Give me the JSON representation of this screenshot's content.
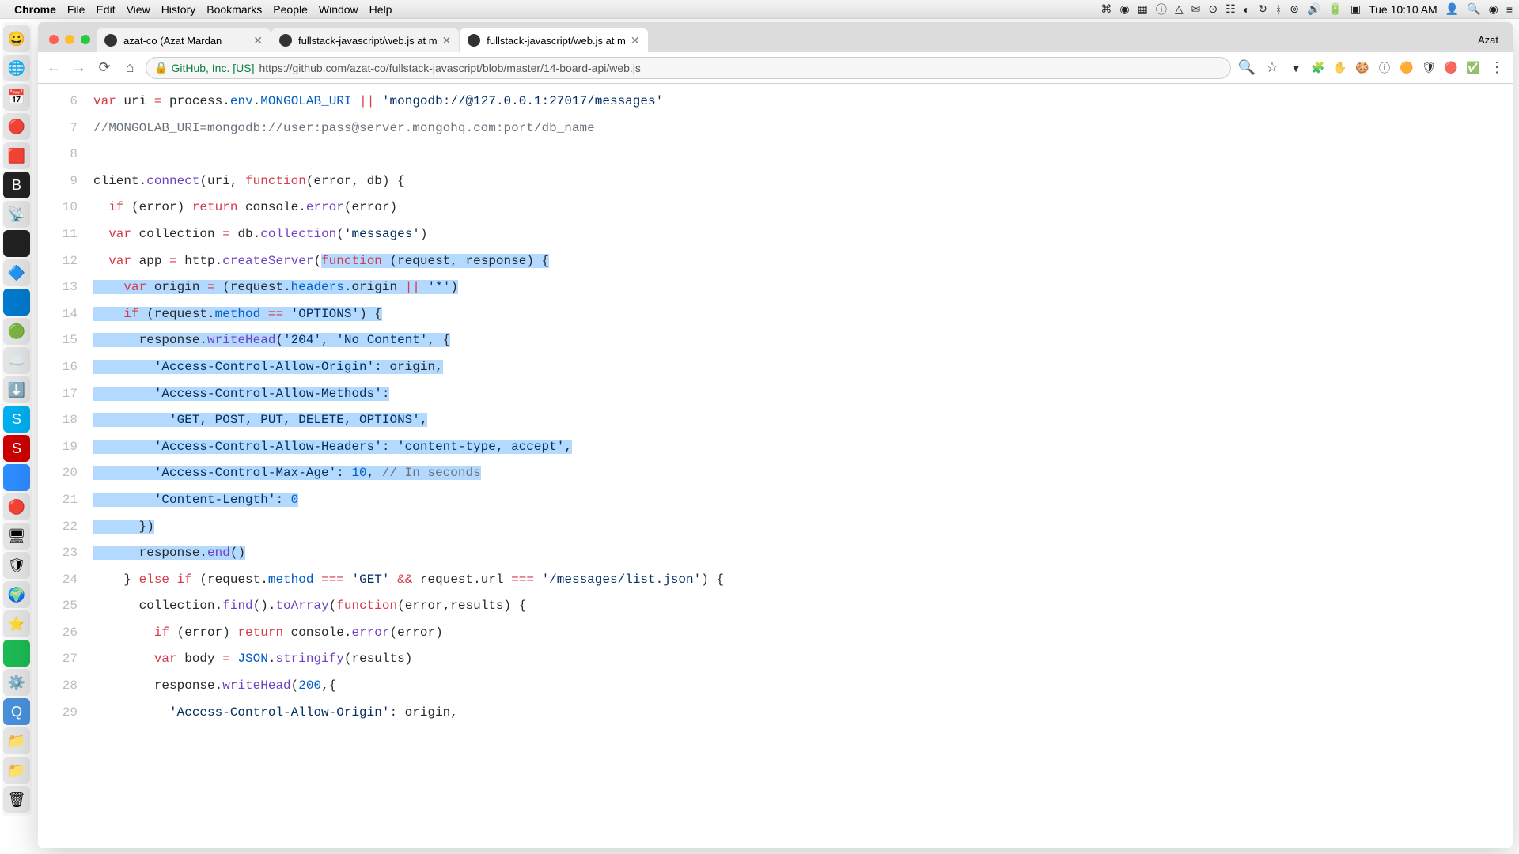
{
  "menubar": {
    "app": "Chrome",
    "items": [
      "File",
      "Edit",
      "View",
      "History",
      "Bookmarks",
      "People",
      "Window",
      "Help"
    ],
    "clock": "Tue 10:10 AM"
  },
  "chrome": {
    "tabs": [
      {
        "title": "azat-co (Azat Mardan",
        "active": false
      },
      {
        "title": "fullstack-javascript/web.js at m",
        "active": false
      },
      {
        "title": "fullstack-javascript/web.js at m",
        "active": true
      }
    ],
    "user": "Azat",
    "security_label": "GitHub, Inc. [US]",
    "url": "https://github.com/azat-co/fullstack-javascript/blob/master/14-board-api/web.js"
  },
  "code": {
    "lines": [
      {
        "n": 6,
        "indent": 0,
        "sel": false,
        "tokens": [
          [
            "kw",
            "var"
          ],
          [
            "id",
            " uri "
          ],
          [
            "kw",
            "="
          ],
          [
            "id",
            " process"
          ],
          [
            "id",
            "."
          ],
          [
            "prop",
            "env"
          ],
          [
            "id",
            "."
          ],
          [
            "const",
            "MONGOLAB_URI"
          ],
          [
            "id",
            " "
          ],
          [
            "kw",
            "||"
          ],
          [
            "id",
            " "
          ],
          [
            "str",
            "'mongodb://@127.0.0.1:27017/messages'"
          ]
        ]
      },
      {
        "n": 7,
        "indent": 0,
        "sel": false,
        "tokens": [
          [
            "cmt",
            "//MONGOLAB_URI=mongodb://user:pass@server.mongohq.com:port/db_name"
          ]
        ]
      },
      {
        "n": 8,
        "indent": 0,
        "sel": false,
        "tokens": []
      },
      {
        "n": 9,
        "indent": 0,
        "sel": false,
        "tokens": [
          [
            "id",
            "client"
          ],
          [
            "id",
            "."
          ],
          [
            "fn",
            "connect"
          ],
          [
            "id",
            "(uri, "
          ],
          [
            "kw",
            "function"
          ],
          [
            "id",
            "(error, db) {"
          ]
        ]
      },
      {
        "n": 10,
        "indent": 1,
        "sel": false,
        "tokens": [
          [
            "kw",
            "if"
          ],
          [
            "id",
            " (error) "
          ],
          [
            "kw",
            "return"
          ],
          [
            "id",
            " console."
          ],
          [
            "fn",
            "error"
          ],
          [
            "id",
            "(error)"
          ]
        ]
      },
      {
        "n": 11,
        "indent": 1,
        "sel": false,
        "tokens": [
          [
            "kw",
            "var"
          ],
          [
            "id",
            " collection "
          ],
          [
            "kw",
            "="
          ],
          [
            "id",
            " db."
          ],
          [
            "fn",
            "collection"
          ],
          [
            "id",
            "("
          ],
          [
            "str",
            "'messages'"
          ],
          [
            "id",
            ")"
          ]
        ]
      },
      {
        "n": 12,
        "indent": 1,
        "sel": "partial",
        "unsel_tokens": [
          [
            "kw",
            "var"
          ],
          [
            "id",
            " app "
          ],
          [
            "kw",
            "="
          ],
          [
            "id",
            " http."
          ],
          [
            "fn",
            "createServer"
          ],
          [
            "id",
            "("
          ]
        ],
        "sel_tokens": [
          [
            "kw",
            "function"
          ],
          [
            "id",
            " (request, response) {"
          ]
        ]
      },
      {
        "n": 13,
        "indent": 2,
        "sel": true,
        "tokens": [
          [
            "kw",
            "var"
          ],
          [
            "id",
            " origin "
          ],
          [
            "kw",
            "="
          ],
          [
            "id",
            " (request."
          ],
          [
            "prop",
            "headers"
          ],
          [
            "id",
            ".origin "
          ],
          [
            "kw",
            "||"
          ],
          [
            "id",
            " "
          ],
          [
            "str",
            "'*'"
          ],
          [
            "id",
            ")"
          ]
        ]
      },
      {
        "n": 14,
        "indent": 2,
        "sel": true,
        "tokens": [
          [
            "kw",
            "if"
          ],
          [
            "id",
            " (request."
          ],
          [
            "prop",
            "method"
          ],
          [
            "id",
            " "
          ],
          [
            "kw",
            "=="
          ],
          [
            "id",
            " "
          ],
          [
            "str",
            "'OPTIONS'"
          ],
          [
            "id",
            ") {"
          ]
        ]
      },
      {
        "n": 15,
        "indent": 3,
        "sel": true,
        "tokens": [
          [
            "id",
            "response."
          ],
          [
            "fn",
            "writeHead"
          ],
          [
            "id",
            "("
          ],
          [
            "str",
            "'204'"
          ],
          [
            "id",
            ", "
          ],
          [
            "str",
            "'No Content'"
          ],
          [
            "id",
            ", {"
          ]
        ]
      },
      {
        "n": 16,
        "indent": 4,
        "sel": true,
        "tokens": [
          [
            "str",
            "'Access-Control-Allow-Origin'"
          ],
          [
            "id",
            ": origin,"
          ]
        ]
      },
      {
        "n": 17,
        "indent": 4,
        "sel": true,
        "tokens": [
          [
            "str",
            "'Access-Control-Allow-Methods'"
          ],
          [
            "id",
            ":"
          ]
        ]
      },
      {
        "n": 18,
        "indent": 5,
        "sel": true,
        "tokens": [
          [
            "str",
            "'GET, POST, PUT, DELETE, OPTIONS'"
          ],
          [
            "id",
            ","
          ]
        ]
      },
      {
        "n": 19,
        "indent": 4,
        "sel": true,
        "tokens": [
          [
            "str",
            "'Access-Control-Allow-Headers'"
          ],
          [
            "id",
            ": "
          ],
          [
            "str",
            "'content-type, accept'"
          ],
          [
            "id",
            ","
          ]
        ]
      },
      {
        "n": 20,
        "indent": 4,
        "sel": true,
        "tokens": [
          [
            "str",
            "'Access-Control-Max-Age'"
          ],
          [
            "id",
            ": "
          ],
          [
            "num",
            "10"
          ],
          [
            "id",
            ", "
          ],
          [
            "cmt",
            "// In seconds"
          ]
        ]
      },
      {
        "n": 21,
        "indent": 4,
        "sel": true,
        "tokens": [
          [
            "str",
            "'Content-Length'"
          ],
          [
            "id",
            ": "
          ],
          [
            "num",
            "0"
          ]
        ]
      },
      {
        "n": 22,
        "indent": 3,
        "sel": true,
        "tokens": [
          [
            "id",
            "})"
          ]
        ]
      },
      {
        "n": 23,
        "indent": 3,
        "sel": true,
        "tokens": [
          [
            "id",
            "response."
          ],
          [
            "fn",
            "end"
          ],
          [
            "id",
            "()"
          ]
        ]
      },
      {
        "n": 24,
        "indent": 2,
        "sel": false,
        "tokens": [
          [
            "id",
            "} "
          ],
          [
            "kw",
            "else if"
          ],
          [
            "id",
            " (request."
          ],
          [
            "prop",
            "method"
          ],
          [
            "id",
            " "
          ],
          [
            "kw",
            "==="
          ],
          [
            "id",
            " "
          ],
          [
            "str",
            "'GET'"
          ],
          [
            "id",
            " "
          ],
          [
            "kw",
            "&&"
          ],
          [
            "id",
            " request.url "
          ],
          [
            "kw",
            "==="
          ],
          [
            "id",
            " "
          ],
          [
            "str",
            "'/messages/list.json'"
          ],
          [
            "id",
            ") {"
          ]
        ]
      },
      {
        "n": 25,
        "indent": 3,
        "sel": false,
        "tokens": [
          [
            "id",
            "collection."
          ],
          [
            "fn",
            "find"
          ],
          [
            "id",
            "()."
          ],
          [
            "fn",
            "toArray"
          ],
          [
            "id",
            "("
          ],
          [
            "kw",
            "function"
          ],
          [
            "id",
            "(error,results) {"
          ]
        ]
      },
      {
        "n": 26,
        "indent": 4,
        "sel": false,
        "tokens": [
          [
            "kw",
            "if"
          ],
          [
            "id",
            " (error) "
          ],
          [
            "kw",
            "return"
          ],
          [
            "id",
            " console."
          ],
          [
            "fn",
            "error"
          ],
          [
            "id",
            "(error)"
          ]
        ]
      },
      {
        "n": 27,
        "indent": 4,
        "sel": false,
        "tokens": [
          [
            "kw",
            "var"
          ],
          [
            "id",
            " body "
          ],
          [
            "kw",
            "="
          ],
          [
            "id",
            " "
          ],
          [
            "const",
            "JSON"
          ],
          [
            "id",
            "."
          ],
          [
            "fn",
            "stringify"
          ],
          [
            "id",
            "(results)"
          ]
        ]
      },
      {
        "n": 28,
        "indent": 4,
        "sel": false,
        "tokens": [
          [
            "id",
            "response."
          ],
          [
            "fn",
            "writeHead"
          ],
          [
            "id",
            "("
          ],
          [
            "num",
            "200"
          ],
          [
            "id",
            ",{"
          ]
        ]
      },
      {
        "n": 29,
        "indent": 5,
        "sel": false,
        "tokens": [
          [
            "str",
            "'Access-Control-Allow-Origin'"
          ],
          [
            "id",
            ": origin,"
          ]
        ]
      }
    ]
  }
}
